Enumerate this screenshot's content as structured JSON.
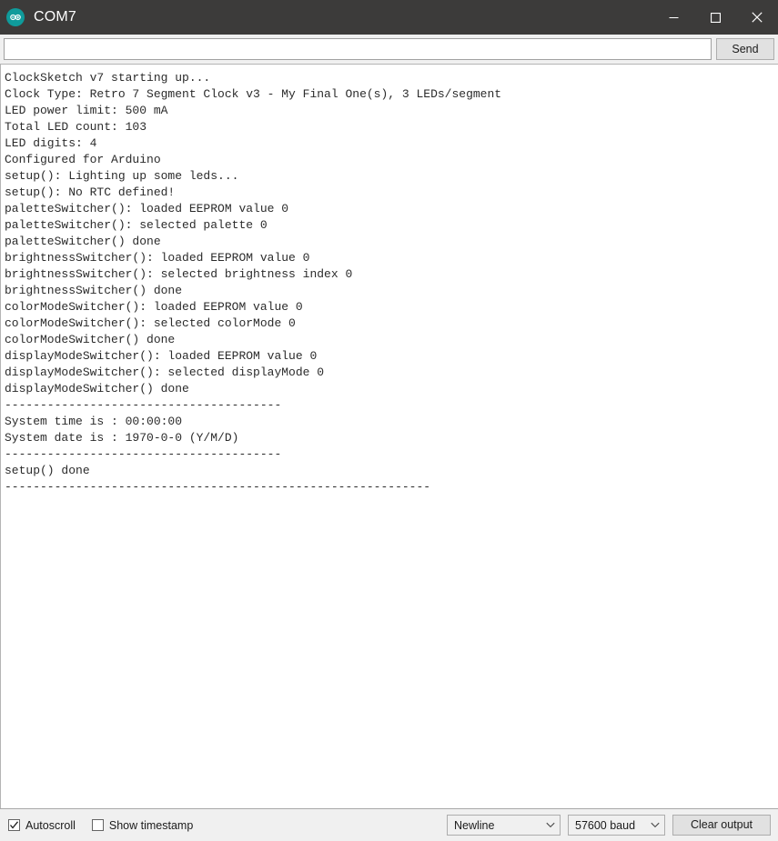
{
  "window": {
    "title": "COM7",
    "icon": "arduino-logo-icon",
    "minimize_label": "Minimize",
    "maximize_label": "Maximize",
    "close_label": "Close"
  },
  "send_row": {
    "input_value": "",
    "input_placeholder": "",
    "send_label": "Send"
  },
  "console": {
    "lines": [
      "ClockSketch v7 starting up...",
      "Clock Type: Retro 7 Segment Clock v3 - My Final One(s), 3 LEDs/segment",
      "LED power limit: 500 mA",
      "Total LED count: 103",
      "LED digits: 4",
      "Configured for Arduino",
      "setup(): Lighting up some leds...",
      "setup(): No RTC defined!",
      "paletteSwitcher(): loaded EEPROM value 0",
      "paletteSwitcher(): selected palette 0",
      "paletteSwitcher() done",
      "brightnessSwitcher(): loaded EEPROM value 0",
      "brightnessSwitcher(): selected brightness index 0",
      "brightnessSwitcher() done",
      "colorModeSwitcher(): loaded EEPROM value 0",
      "colorModeSwitcher(): selected colorMode 0",
      "colorModeSwitcher() done",
      "displayModeSwitcher(): loaded EEPROM value 0",
      "displayModeSwitcher(): selected displayMode 0",
      "displayModeSwitcher() done",
      "---------------------------------------",
      "System time is : 00:00:00",
      "System date is : 1970-0-0 (Y/M/D)",
      "---------------------------------------",
      "setup() done",
      "------------------------------------------------------------"
    ]
  },
  "status_bar": {
    "autoscroll_label": "Autoscroll",
    "autoscroll_checked": true,
    "show_timestamp_label": "Show timestamp",
    "show_timestamp_checked": false,
    "line_ending_value": "Newline",
    "baud_value": "57600 baud",
    "clear_output_label": "Clear output"
  },
  "colors": {
    "titlebar_bg": "#3c3b3a",
    "titlebar_fg": "#ffffff",
    "icon_teal": "#0f9b9b",
    "console_bg": "#ffffff",
    "console_fg": "#2b2b2b",
    "chrome_bg": "#f0f0f0"
  }
}
